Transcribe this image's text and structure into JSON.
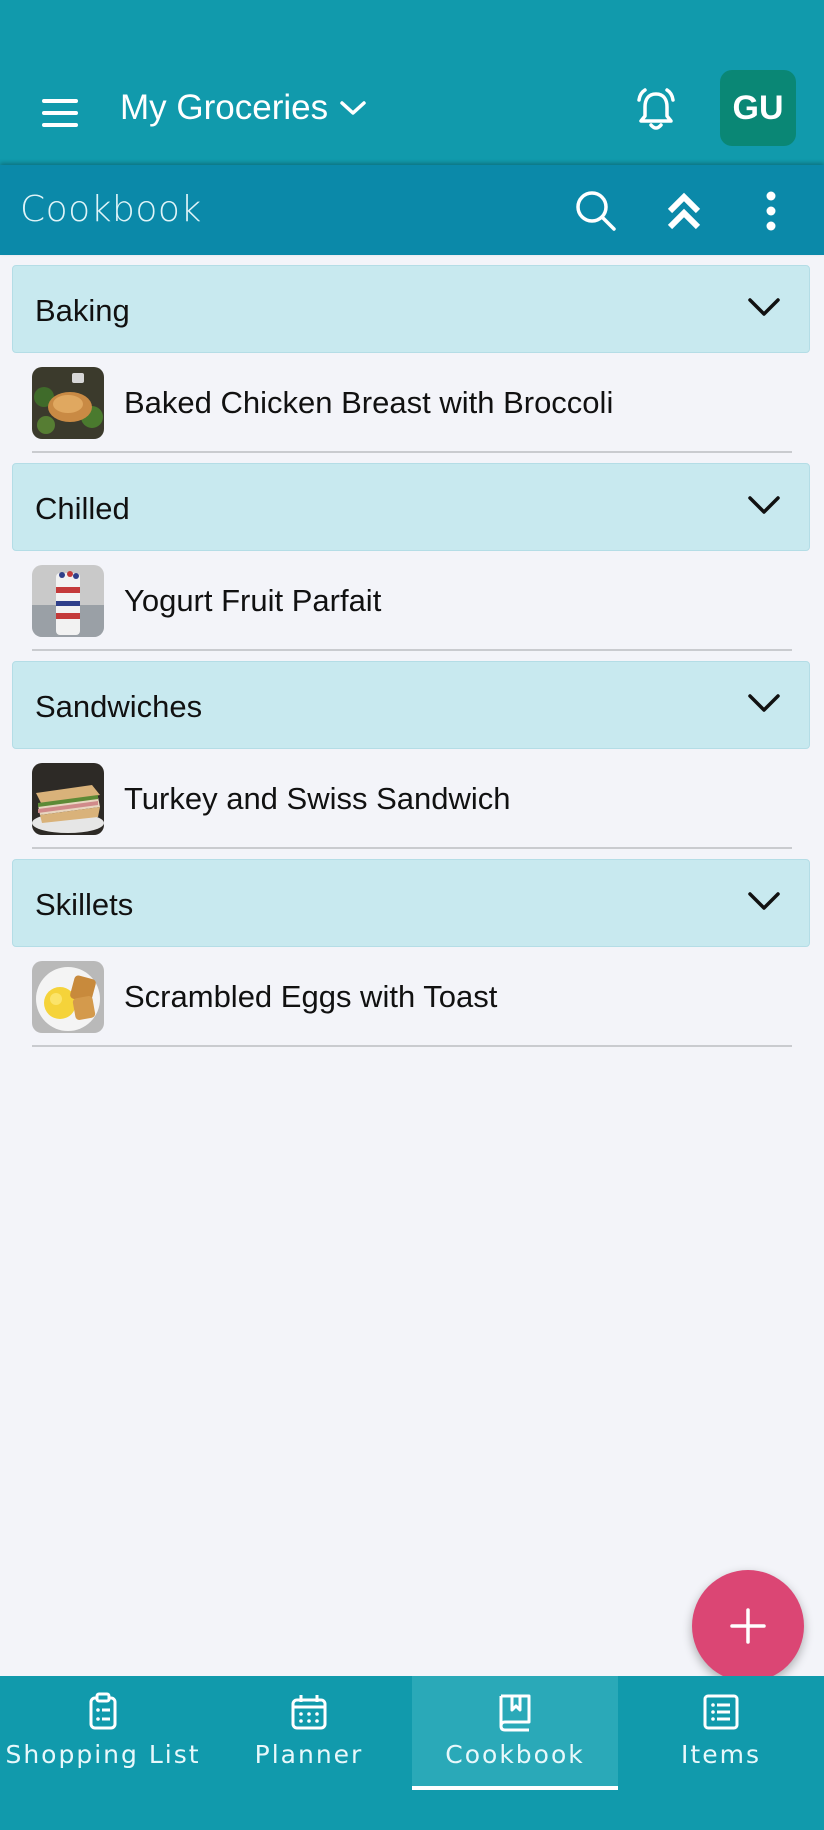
{
  "header": {
    "list_name": "My Groceries",
    "avatar_initials": "GU"
  },
  "toolbar": {
    "title": "Cookbook"
  },
  "groups": [
    {
      "label": "Baking",
      "recipes": [
        {
          "name": "Baked Chicken Breast with Broccoli"
        }
      ]
    },
    {
      "label": "Chilled",
      "recipes": [
        {
          "name": "Yogurt Fruit Parfait"
        }
      ]
    },
    {
      "label": "Sandwiches",
      "recipes": [
        {
          "name": "Turkey and Swiss Sandwich"
        }
      ]
    },
    {
      "label": "Skillets",
      "recipes": [
        {
          "name": "Scrambled Eggs with Toast"
        }
      ]
    }
  ],
  "bottom_nav": {
    "items": [
      {
        "label": "Shopping List",
        "icon": "clipboard-list-icon"
      },
      {
        "label": "Planner",
        "icon": "calendar-icon"
      },
      {
        "label": "Cookbook",
        "icon": "book-icon",
        "active": true
      },
      {
        "label": "Items",
        "icon": "list-icon"
      }
    ]
  },
  "colors": {
    "primary": "#119aac",
    "subheader": "#0b89a9",
    "group_bg": "#c8e9ef",
    "fab": "#db4674",
    "avatar": "#0a8775",
    "background": "#f3f4f9"
  }
}
